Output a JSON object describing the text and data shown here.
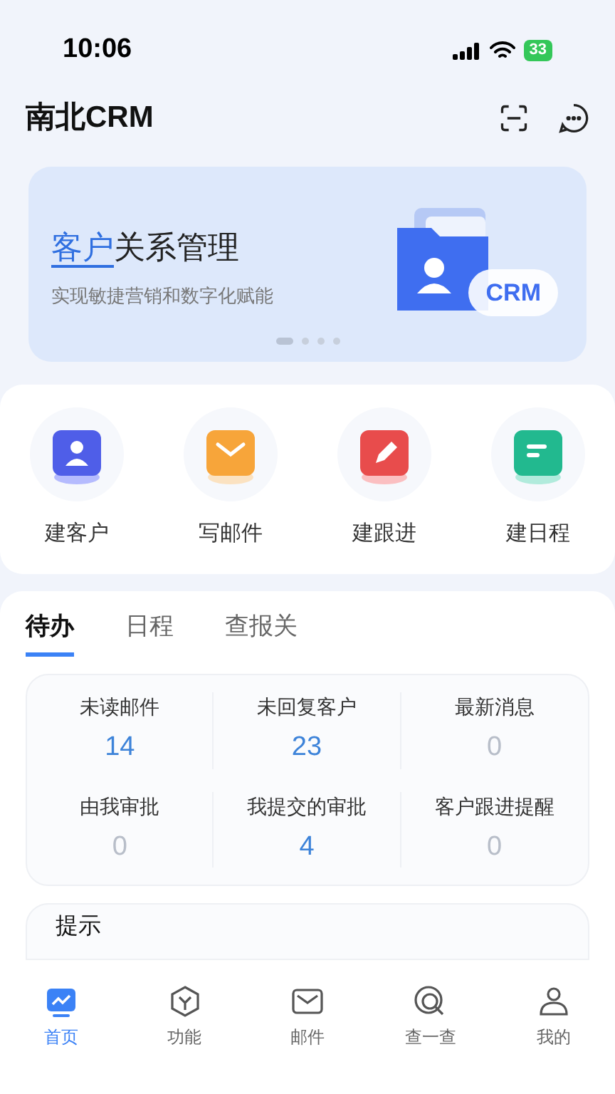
{
  "status_bar": {
    "time": "10:06",
    "battery": "33"
  },
  "header": {
    "title": "南北CRM"
  },
  "banner": {
    "title_highlight": "客户",
    "title_rest": "关系管理",
    "subtitle": "实现敏捷营销和数字化赋能",
    "badge": "CRM",
    "pages": [
      {
        "selected": true
      },
      {
        "selected": false
      },
      {
        "selected": false
      },
      {
        "selected": false
      }
    ]
  },
  "quick_actions": [
    {
      "label": "建客户",
      "kind": "customer"
    },
    {
      "label": "写邮件",
      "kind": "mail"
    },
    {
      "label": "建跟进",
      "kind": "followup"
    },
    {
      "label": "建日程",
      "kind": "schedule"
    }
  ],
  "tabs": [
    {
      "label": "待办",
      "selected": true
    },
    {
      "label": "日程",
      "selected": false
    },
    {
      "label": "查报关",
      "selected": false
    }
  ],
  "stats": [
    {
      "label": "未读邮件",
      "value": "14",
      "muted": false
    },
    {
      "label": "未回复客户",
      "value": "23",
      "muted": false
    },
    {
      "label": "最新消息",
      "value": "0",
      "muted": true
    },
    {
      "label": "由我审批",
      "value": "0",
      "muted": true
    },
    {
      "label": "我提交的审批",
      "value": "4",
      "muted": false
    },
    {
      "label": "客户跟进提醒",
      "value": "0",
      "muted": true
    }
  ],
  "hint_card": {
    "title": "提示"
  },
  "bottom_nav": [
    {
      "label": "首页",
      "kind": "home",
      "selected": true
    },
    {
      "label": "功能",
      "kind": "features",
      "selected": false
    },
    {
      "label": "邮件",
      "kind": "mail",
      "selected": false
    },
    {
      "label": "查一查",
      "kind": "search",
      "selected": false
    },
    {
      "label": "我的",
      "kind": "me",
      "selected": false
    }
  ]
}
